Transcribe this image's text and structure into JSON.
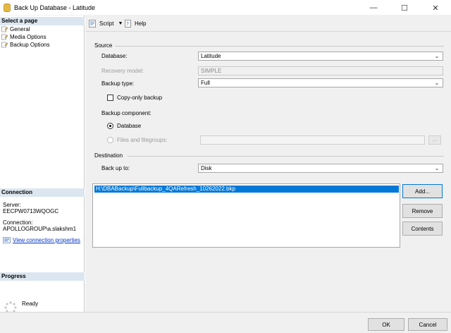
{
  "window": {
    "title": "Back Up Database - Latitude",
    "minimize_glyph": "—",
    "maximize_glyph": "☐",
    "close_glyph": "✕"
  },
  "sidebar": {
    "select_page_header": "Select a page",
    "pages": [
      {
        "label": "General",
        "icon": "page-wrench-icon"
      },
      {
        "label": "Media Options",
        "icon": "page-wrench-icon"
      },
      {
        "label": "Backup Options",
        "icon": "page-wrench-icon"
      }
    ],
    "connection_header": "Connection",
    "server_label": "Server:",
    "server_value": "EECPW0713WQOGC",
    "connection_label": "Connection:",
    "connection_value": "APOLLOGROUP\\a.slakshm1",
    "view_connection_link": "View connection properties",
    "progress_header": "Progress",
    "progress_status": "Ready"
  },
  "toolbar": {
    "script_label": "Script",
    "help_label": "Help"
  },
  "source": {
    "group_label": "Source",
    "database_label": "Database:",
    "database_value": "Latitude",
    "recovery_model_label": "Recovery model:",
    "recovery_model_value": "SIMPLE",
    "backup_type_label": "Backup type:",
    "backup_type_value": "Full",
    "copy_only_label": "Copy-only backup",
    "copy_only_checked": false,
    "backup_component_label": "Backup component:",
    "component_database_label": "Database",
    "component_files_label": "Files and filegroups:",
    "files_browse_label": "..."
  },
  "destination": {
    "group_label": "Destination",
    "back_up_to_label": "Back up to:",
    "back_up_to_value": "Disk",
    "paths": [
      "H:\\DBABackup\\Fullbackup_4QARefresh_10262022.bkp"
    ],
    "add_label": "Add...",
    "remove_label": "Remove",
    "contents_label": "Contents"
  },
  "footer": {
    "ok_label": "OK",
    "cancel_label": "Cancel"
  },
  "colors": {
    "selection": "#0078d7",
    "panel_header": "#dce6f0",
    "content_bg": "#f0f0f0",
    "link": "#0033cc"
  }
}
